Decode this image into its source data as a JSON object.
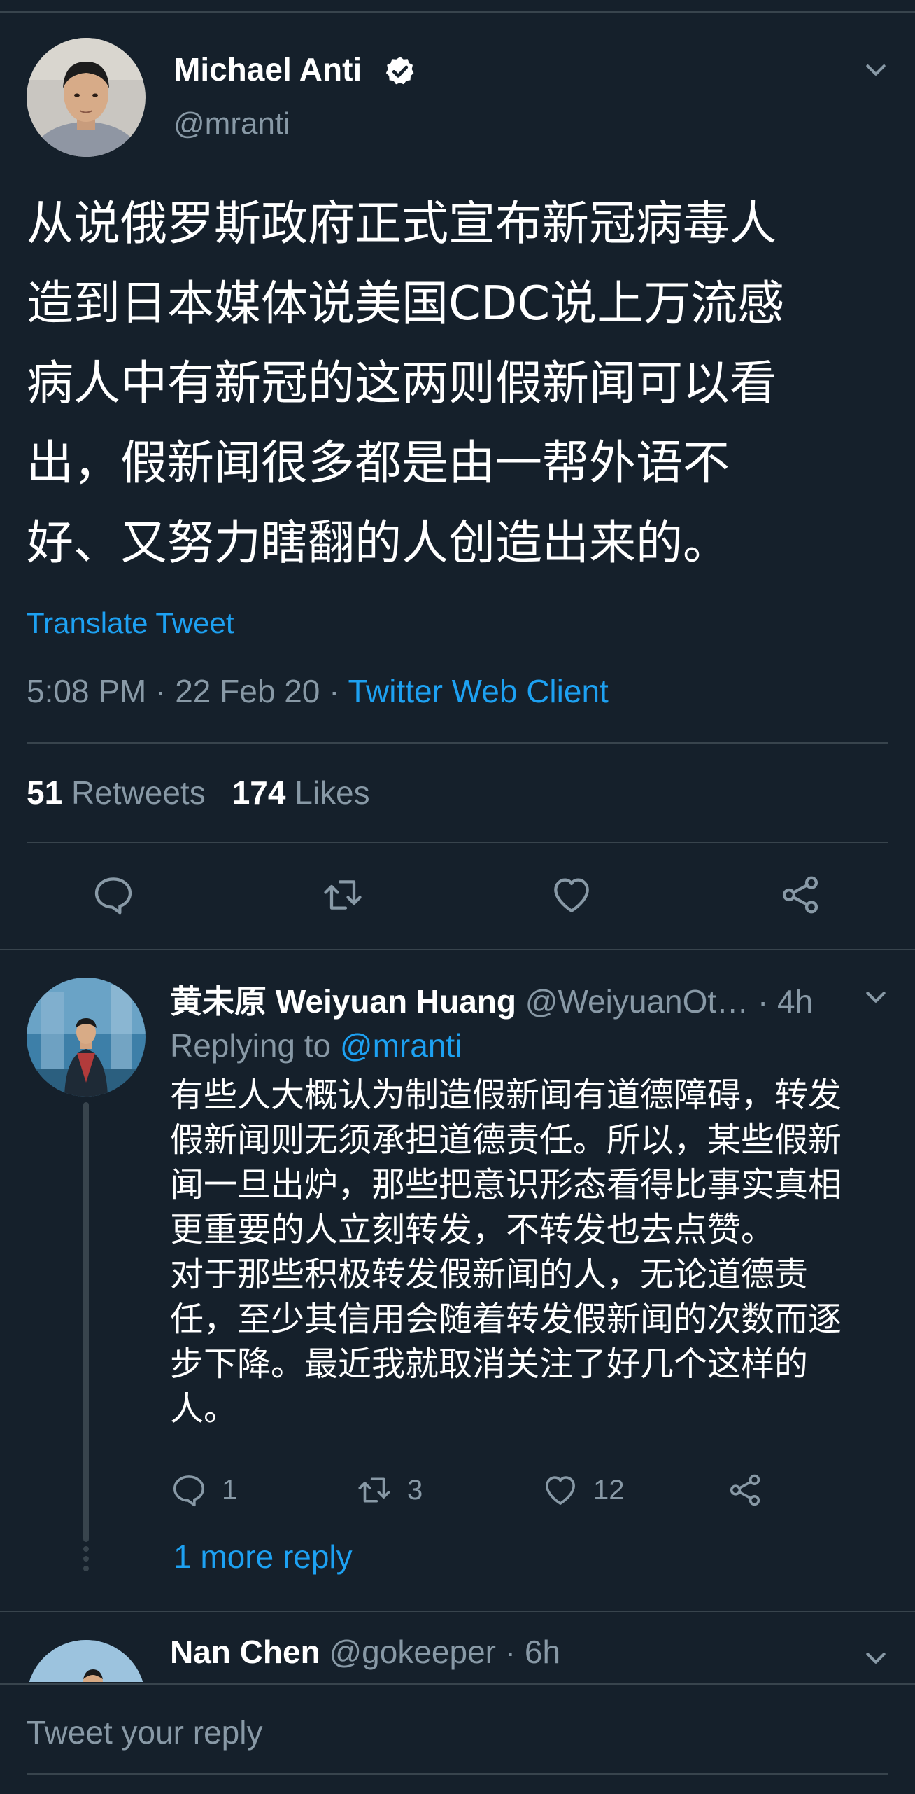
{
  "colors": {
    "background": "#15202b",
    "accent": "#1da1f2",
    "secondary_text": "#8899a6",
    "divider": "#38444d"
  },
  "main_tweet": {
    "author": {
      "name": "Michael Anti",
      "handle": "@mranti",
      "verified": true
    },
    "text": "从说俄罗斯政府正式宣布新冠病毒人\n造到日本媒体说美国CDC说上万流感\n病人中有新冠的这两则假新闻可以看\n出，假新闻很多都是由一帮外语不\n好、又努力瞎翻的人创造出来的。",
    "translate_label": "Translate Tweet",
    "time": "5:08 PM",
    "date": "22 Feb 20",
    "separator": " · ",
    "client": "Twitter Web Client",
    "retweets_count": "51",
    "retweets_label": "Retweets",
    "likes_count": "174",
    "likes_label": "Likes",
    "action_icons": [
      "reply-icon",
      "retweet-icon",
      "like-icon",
      "share-icon"
    ]
  },
  "reply": {
    "name": "黄未原 Weiyuan Huang",
    "handle": "@WeiyuanOt…",
    "time": " · 4h",
    "replying_to_label": "Replying to ",
    "replying_to_handle": "@mranti",
    "text": "有些人大概认为制造假新闻有道德障碍，转发\n假新闻则无须承担道德责任。所以，某些假新\n闻一旦出炉，那些把意识形态看得比事实真相\n更重要的人立刻转发，不转发也去点赞。\n对于那些积极转发假新闻的人，无论道德责\n任，至少其信用会随着转发假新闻的次数而逐\n步下降。最近我就取消关注了好几个这样的\n人。",
    "reply_count": "1",
    "retweet_count": "3",
    "like_count": "12",
    "more_replies": "1 more reply"
  },
  "second_reply": {
    "name": "Nan Chen",
    "handle": "@gokeeper",
    "time": " · 6h"
  },
  "compose": {
    "placeholder": "Tweet your reply"
  }
}
